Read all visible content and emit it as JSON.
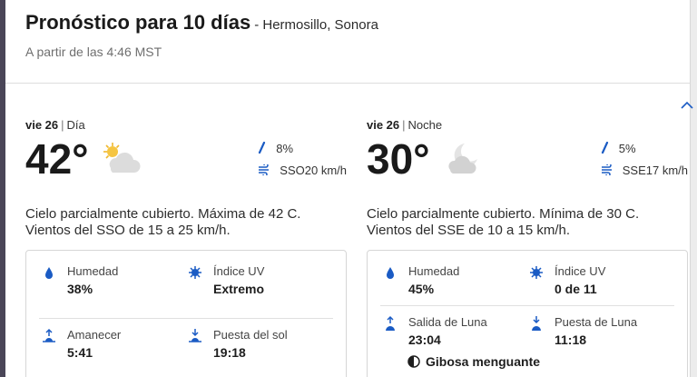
{
  "header": {
    "title": "Pronóstico para 10 días",
    "location": "- Hermosillo, Sonora",
    "updated": "A partir de las 4:46 MST"
  },
  "day": {
    "date": "vie 26",
    "period": "Día",
    "temp": "42°",
    "icon": "partly-cloudy-sun-icon",
    "precip": "8%",
    "wind": "SSO20 km/h",
    "desc1": "Cielo parcialmente cubierto. Máxima de 42 C.",
    "desc2": "Vientos del SSO de 15 a 25 km/h.",
    "humidity_label": "Humedad",
    "humidity": "38%",
    "uv_label": "Índice UV",
    "uv": "Extremo",
    "sunrise_label": "Amanecer",
    "sunrise": "5:41",
    "sunset_label": "Puesta del sol",
    "sunset": "19:18"
  },
  "night": {
    "date": "vie 26",
    "period": "Noche",
    "temp": "30°",
    "icon": "partly-cloudy-moon-icon",
    "precip": "5%",
    "wind": "SSE17 km/h",
    "desc1": "Cielo parcialmente cubierto. Mínima de 30 C.",
    "desc2": "Vientos del SSE de 10 a 15 km/h.",
    "humidity_label": "Humedad",
    "humidity": "45%",
    "uv_label": "Índice UV",
    "uv": "0 de 11",
    "moonrise_label": "Salida de Luna",
    "moonrise": "23:04",
    "moonset_label": "Puesta de Luna",
    "moonset": "11:18",
    "moon_phase": "Gibosa menguante"
  },
  "colors": {
    "accent": "#1a5bc4",
    "icon_sun": "#f5c542",
    "cloud": "#d9d9d9"
  }
}
